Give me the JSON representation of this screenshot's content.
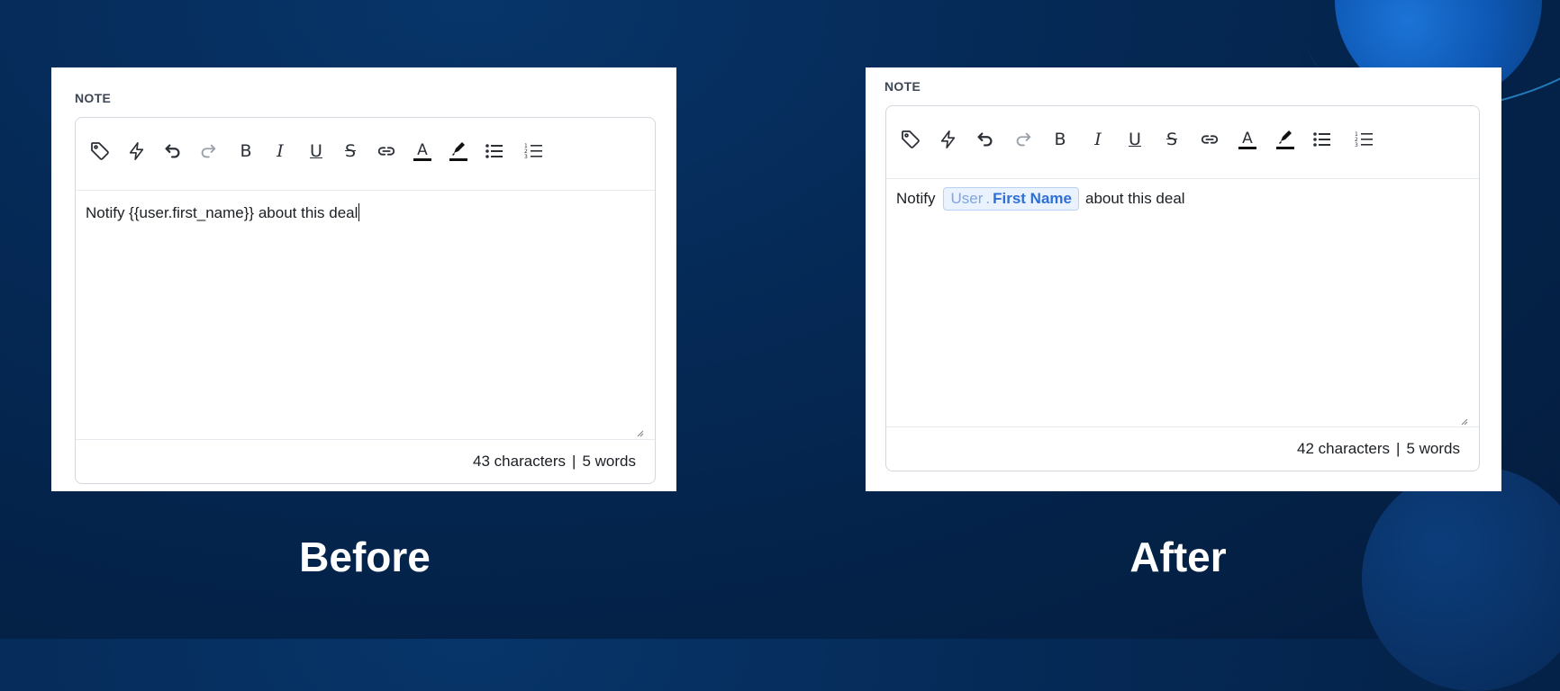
{
  "before": {
    "section_label": "NOTE",
    "content_text": "Notify {{user.first_name}} about this deal",
    "char_count": "43 characters",
    "separator": "|",
    "word_count": "5 words",
    "caption": "Before"
  },
  "after": {
    "section_label": "NOTE",
    "content_prefix": "Notify",
    "token_object": "User",
    "token_dot": ".",
    "token_field": "First Name",
    "content_suffix": "about this deal",
    "char_count": "42 characters",
    "separator": "|",
    "word_count": "5 words",
    "caption": "After"
  },
  "toolbar_icons": [
    "tag-icon",
    "lightning-icon",
    "undo-icon",
    "redo-icon",
    "bold-icon",
    "italic-icon",
    "underline-icon",
    "strikethrough-icon",
    "link-icon",
    "text-color-icon",
    "highlight-icon",
    "bullet-list-icon",
    "numbered-list-icon"
  ],
  "colors": {
    "background": "#04234a",
    "token_bg": "#eaf2fd",
    "token_field": "#2e6fd8",
    "token_object": "#7ea5e3"
  }
}
